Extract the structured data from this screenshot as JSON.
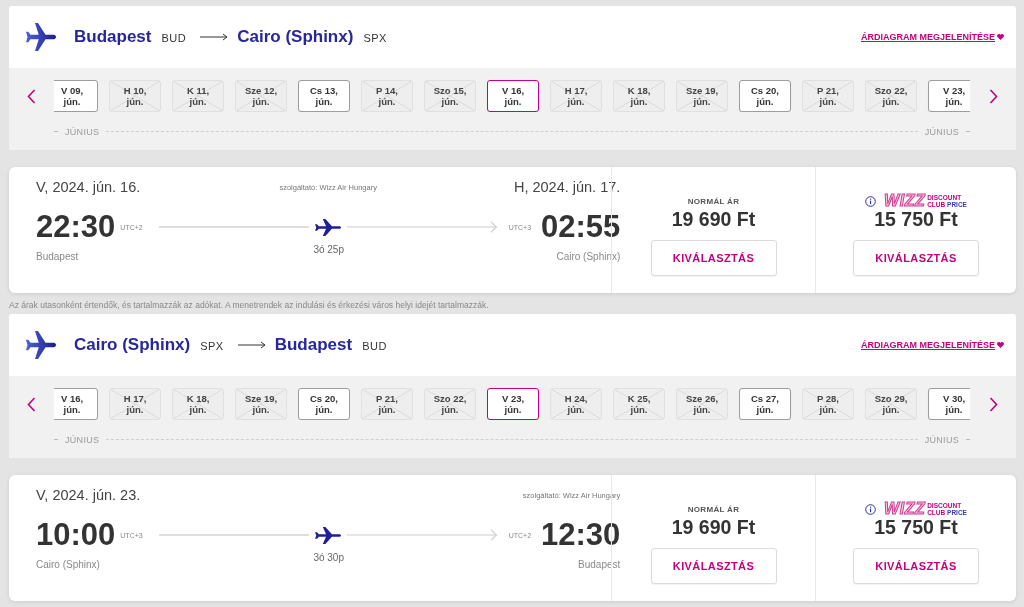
{
  "outbound": {
    "header": {
      "origin_city": "Budapest",
      "origin_code": "BUD",
      "destination_city": "Cairo (Sphinx)",
      "destination_code": "SPX",
      "chart_link": "ÁRDIAGRAM MEGJELENÍTÉSE"
    },
    "dates": [
      {
        "day": "V 09,",
        "month": "jún.",
        "available": true,
        "selected": false
      },
      {
        "day": "H 10,",
        "month": "jún.",
        "available": false,
        "selected": false
      },
      {
        "day": "K 11,",
        "month": "jún.",
        "available": false,
        "selected": false
      },
      {
        "day": "Sze 12,",
        "month": "jún.",
        "available": false,
        "selected": false
      },
      {
        "day": "Cs 13,",
        "month": "jún.",
        "available": true,
        "selected": false
      },
      {
        "day": "P 14,",
        "month": "jún.",
        "available": false,
        "selected": false
      },
      {
        "day": "Szo 15,",
        "month": "jún.",
        "available": false,
        "selected": false
      },
      {
        "day": "V 16,",
        "month": "jún.",
        "available": true,
        "selected": true
      },
      {
        "day": "H 17,",
        "month": "jún.",
        "available": false,
        "selected": false
      },
      {
        "day": "K 18,",
        "month": "jún.",
        "available": false,
        "selected": false
      },
      {
        "day": "Sze 19,",
        "month": "jún.",
        "available": false,
        "selected": false
      },
      {
        "day": "Cs 20,",
        "month": "jún.",
        "available": true,
        "selected": false
      },
      {
        "day": "P 21,",
        "month": "jún.",
        "available": false,
        "selected": false
      },
      {
        "day": "Szo 22,",
        "month": "jún.",
        "available": false,
        "selected": false
      },
      {
        "day": "V 23,",
        "month": "jún.",
        "available": true,
        "selected": false
      }
    ],
    "month_start": "JÚNIUS",
    "month_end": "JÚNIUS",
    "flight": {
      "departure_date": "V, 2024. jún. 16.",
      "operator": "szolgáltató: Wizz Air Hungary",
      "arrival_date": "H, 2024. jún. 17.",
      "departure_time": "22:30",
      "departure_tz": "UTC+2",
      "duration": "3ó 25p",
      "arrival_tz": "UTC+3",
      "arrival_time": "02:55",
      "departure_city": "Budapest",
      "arrival_city": "Cairo (Sphinx)"
    },
    "fares": [
      {
        "kind": "standard",
        "label": "NORMÁL ÁR",
        "price": "19 690 Ft",
        "button": "KIVÁLASZTÁS"
      },
      {
        "kind": "club",
        "wordmark": "WIZZ",
        "logo_line_1": "DISCOUNT",
        "logo_line_2": [
          "CLUB",
          "PRICE"
        ],
        "price": "15 750 Ft",
        "button": "KIVÁLASZTÁS"
      }
    ]
  },
  "footnote": "Az árak utasonként értendők, és tartalmazzák az adókat. A menetrendek az indulási és érkezési város helyi idejét tartalmazzák.",
  "return": {
    "header": {
      "origin_city": "Cairo (Sphinx)",
      "origin_code": "SPX",
      "destination_city": "Budapest",
      "destination_code": "BUD",
      "chart_link": "ÁRDIAGRAM MEGJELENÍTÉSE"
    },
    "dates": [
      {
        "day": "V 16,",
        "month": "jún.",
        "available": true,
        "selected": false
      },
      {
        "day": "H 17,",
        "month": "jún.",
        "available": false,
        "selected": false
      },
      {
        "day": "K 18,",
        "month": "jún.",
        "available": false,
        "selected": false
      },
      {
        "day": "Sze 19,",
        "month": "jún.",
        "available": false,
        "selected": false
      },
      {
        "day": "Cs 20,",
        "month": "jún.",
        "available": true,
        "selected": false
      },
      {
        "day": "P 21,",
        "month": "jún.",
        "available": false,
        "selected": false
      },
      {
        "day": "Szo 22,",
        "month": "jún.",
        "available": false,
        "selected": false
      },
      {
        "day": "V 23,",
        "month": "jún.",
        "available": true,
        "selected": true
      },
      {
        "day": "H 24,",
        "month": "jún.",
        "available": false,
        "selected": false
      },
      {
        "day": "K 25,",
        "month": "jún.",
        "available": false,
        "selected": false
      },
      {
        "day": "Sze 26,",
        "month": "jún.",
        "available": false,
        "selected": false
      },
      {
        "day": "Cs 27,",
        "month": "jún.",
        "available": true,
        "selected": false
      },
      {
        "day": "P 28,",
        "month": "jún.",
        "available": false,
        "selected": false
      },
      {
        "day": "Szo 29,",
        "month": "jún.",
        "available": false,
        "selected": false
      },
      {
        "day": "V 30,",
        "month": "jún.",
        "available": true,
        "selected": false
      }
    ],
    "month_start": "JÚNIUS",
    "month_end": "JÚNIUS",
    "flight": {
      "departure_date": "V, 2024. jún. 23.",
      "operator": "szolgáltató: Wizz Air Hungary",
      "departure_time": "10:00",
      "departure_tz": "UTC+3",
      "duration": "3ó 30p",
      "arrival_tz": "UTC+2",
      "arrival_time": "12:30",
      "departure_city": "Cairo (Sphinx)",
      "arrival_city": "Budapest"
    },
    "fares": [
      {
        "kind": "standard",
        "label": "NORMÁL ÁR",
        "price": "19 690 Ft",
        "button": "KIVÁLASZTÁS"
      },
      {
        "kind": "club",
        "wordmark": "WIZZ",
        "logo_line_1": "DISCOUNT",
        "logo_line_2": [
          "CLUB",
          "PRICE"
        ],
        "price": "15 750 Ft",
        "button": "KIVÁLASZTÁS"
      }
    ]
  }
}
